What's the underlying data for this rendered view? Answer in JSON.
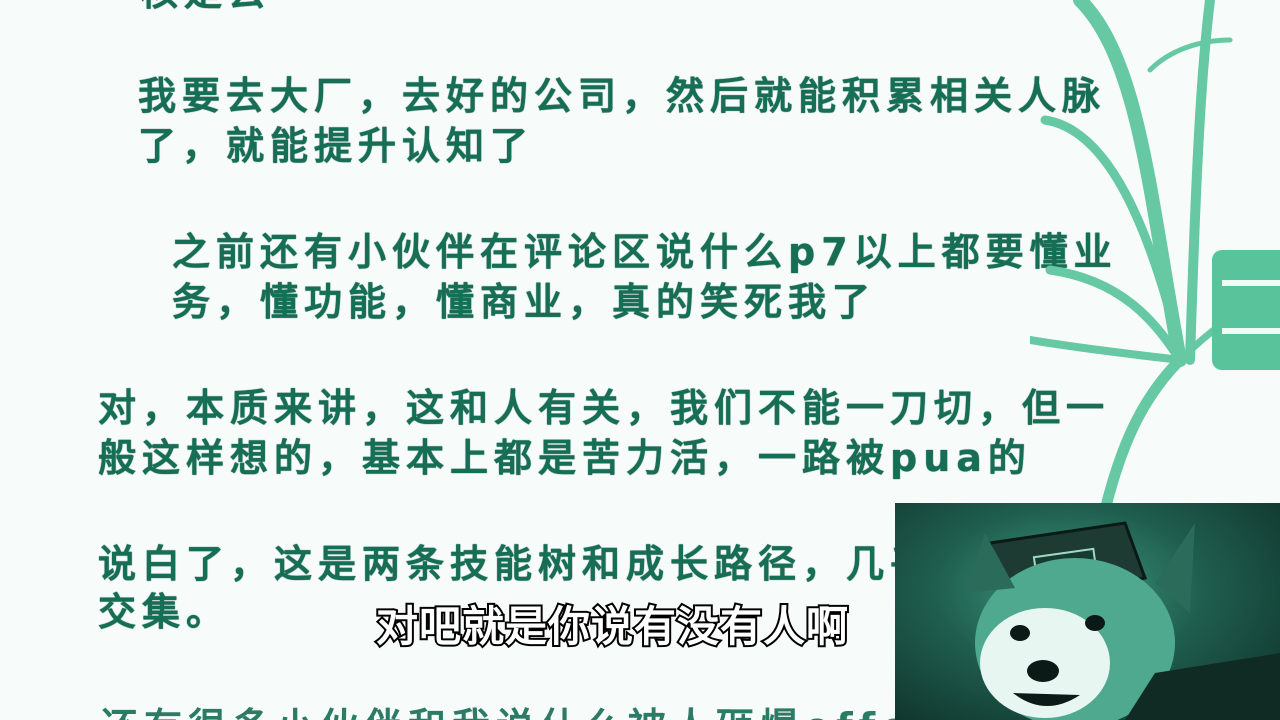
{
  "document": {
    "top_fragment": "核是去",
    "paragraphs": [
      {
        "lines": [
          "我要去大厂，去好的公司，然后就能积累相关人脉",
          "了，就能提升认知了"
        ]
      },
      {
        "lines": [
          "之前还有小伙伴在评论区说什么p7以上都要懂业",
          "务，懂功能，懂商业，真的笑死我了"
        ]
      },
      {
        "lines": [
          "对，本质来讲，这和人有关，我们不能一刀切，但一",
          "般这样想的，基本上都是苦力活，一路被pua的"
        ]
      },
      {
        "lines": [
          "说白了，这是两条技能树和成长路径，几乎没",
          "交集。"
        ]
      }
    ],
    "bottom_fragment": "还有很多小伙伴和我说什么被人砸爆offer就"
  },
  "subtitle": "对吧就是你说有没有人啊",
  "colors": {
    "text": "#166e55",
    "background": "#f7fcfb",
    "accent": "#59c39c",
    "subtitle_fill": "#ffffff",
    "subtitle_stroke": "#000000"
  },
  "icons": {
    "decoration": "leaf-stems-decoration",
    "presenter": "red-panda-avatar"
  }
}
